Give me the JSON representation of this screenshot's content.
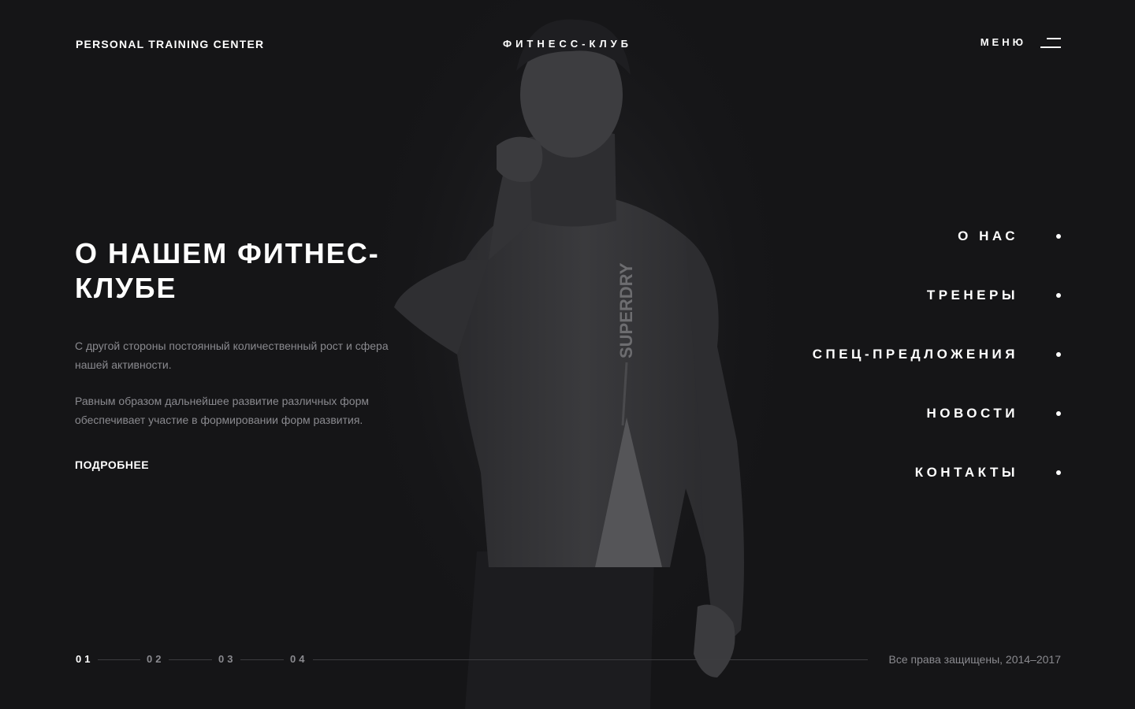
{
  "header": {
    "brand": "PERSONAL TRAINING CENTER",
    "subtitle": "ФИТНЕСС-КЛУБ",
    "menu_label": "МЕНЮ"
  },
  "hero": {
    "title": "О НАШЕМ ФИТНЕС-КЛУБЕ",
    "paragraphs": [
      "С другой стороны постоянный количественный рост и сфера нашей активности.",
      "Равным образом дальнейшее развитие различных форм обеспечивает участие в формировании форм развития."
    ],
    "more_label": "ПОДРОБНЕЕ",
    "shirt_text": "SUPERDRY"
  },
  "nav": {
    "items": [
      {
        "label": "О НАС"
      },
      {
        "label": "ТРЕНЕРЫ"
      },
      {
        "label": "СПЕЦ-ПРЕДЛОЖЕНИЯ"
      },
      {
        "label": "НОВОСТИ"
      },
      {
        "label": "КОНТАКТЫ"
      }
    ]
  },
  "pager": {
    "pages": [
      "01",
      "02",
      "03",
      "04"
    ],
    "active_index": 0
  },
  "footer": {
    "copyright": "Все права защищены, 2014–2017"
  },
  "colors": {
    "background": "#151517",
    "text_primary": "#ffffff",
    "text_muted": "#8a8a8f",
    "line": "#3c3c40"
  }
}
